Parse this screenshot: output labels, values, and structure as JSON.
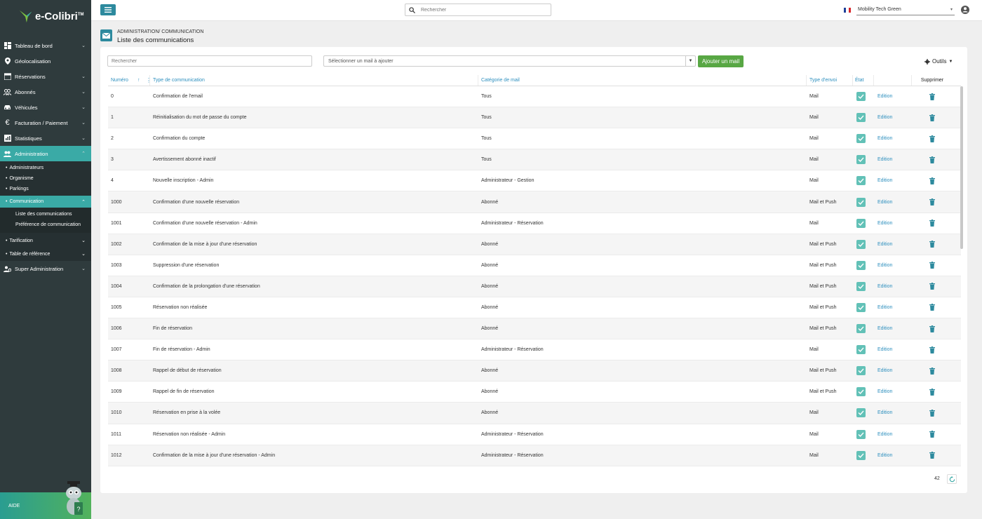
{
  "app": {
    "logo_text": "e-Colibri",
    "logo_tm": "TM"
  },
  "sidebar": {
    "items": [
      {
        "label": "Tableau de bord"
      },
      {
        "label": "Géolocalisation"
      },
      {
        "label": "Réservations"
      },
      {
        "label": "Abonnés"
      },
      {
        "label": "Véhicules"
      },
      {
        "label": "Facturation / Paiement"
      },
      {
        "label": "Statistiques"
      },
      {
        "label": "Administration"
      }
    ],
    "admin_sub": [
      {
        "label": "Administrateurs"
      },
      {
        "label": "Organisme"
      },
      {
        "label": "Parkings"
      },
      {
        "label": "Communication"
      }
    ],
    "comm_sub": [
      {
        "label": "Liste des communications"
      },
      {
        "label": "Préférence de communication"
      }
    ],
    "admin_sub2": [
      {
        "label": "Tarification"
      },
      {
        "label": "Table de référence"
      }
    ],
    "super_admin": "Super Administration",
    "help": "AIDE"
  },
  "topbar": {
    "search_placeholder": "Rechercher",
    "org": "Mobility Tech Green"
  },
  "header": {
    "breadcrumb": "ADMINISTRATION/ COMMUNICATION",
    "title": "Liste des communications"
  },
  "toolbar": {
    "search_placeholder": "Rechercher",
    "mail_select": "Sélectionner un mail à ajouter",
    "add_label": "Ajouter un mail",
    "tools_label": "Outils"
  },
  "table": {
    "headers": [
      "Numéro",
      "Type de communication",
      "Catégorie de mail",
      "Type d'envoi",
      "État",
      "Supprimer"
    ],
    "edit_label": "Edition",
    "rows": [
      {
        "num": "0",
        "type": "Confirmation de l'email",
        "cat": "Tous",
        "envoi": "Mail"
      },
      {
        "num": "1",
        "type": "Réinitialisation du mot de passe du compte",
        "cat": "Tous",
        "envoi": "Mail"
      },
      {
        "num": "2",
        "type": "Confirmation du compte",
        "cat": "Tous",
        "envoi": "Mail"
      },
      {
        "num": "3",
        "type": "Avertissement abonné inactif",
        "cat": "Tous",
        "envoi": "Mail"
      },
      {
        "num": "4",
        "type": "Nouvelle inscription - Admin",
        "cat": "Administrateur - Gestion",
        "envoi": "Mail"
      },
      {
        "num": "1000",
        "type": "Confirmation d'une nouvelle réservation",
        "cat": "Abonné",
        "envoi": "Mail et Push"
      },
      {
        "num": "1001",
        "type": "Confirmation d'une nouvelle réservation - Admin",
        "cat": "Administrateur - Réservation",
        "envoi": "Mail"
      },
      {
        "num": "1002",
        "type": "Confirmation de la mise à jour d'une réservation",
        "cat": "Abonné",
        "envoi": "Mail et Push"
      },
      {
        "num": "1003",
        "type": "Suppression d'une réservation",
        "cat": "Abonné",
        "envoi": "Mail et Push"
      },
      {
        "num": "1004",
        "type": "Confirmation de la prolongation d'une réservation",
        "cat": "Abonné",
        "envoi": "Mail et Push"
      },
      {
        "num": "1005",
        "type": "Réservation non réalisée",
        "cat": "Abonné",
        "envoi": "Mail et Push"
      },
      {
        "num": "1006",
        "type": "Fin de réservation",
        "cat": "Abonné",
        "envoi": "Mail et Push"
      },
      {
        "num": "1007",
        "type": "Fin de réservation - Admin",
        "cat": "Administrateur - Réservation",
        "envoi": "Mail"
      },
      {
        "num": "1008",
        "type": "Rappel de début de réservation",
        "cat": "Abonné",
        "envoi": "Mail et Push"
      },
      {
        "num": "1009",
        "type": "Rappel de fin de réservation",
        "cat": "Abonné",
        "envoi": "Mail et Push"
      },
      {
        "num": "1010",
        "type": "Réservation en prise à la volée",
        "cat": "Abonné",
        "envoi": "Mail"
      },
      {
        "num": "1011",
        "type": "Réservation non réalisée - Admin",
        "cat": "Administrateur - Réservation",
        "envoi": "Mail"
      },
      {
        "num": "1012",
        "type": "Confirmation de la mise à jour d'une réservation - Admin",
        "cat": "Administrateur - Réservation",
        "envoi": "Mail"
      }
    ]
  },
  "footer": {
    "count": "42"
  },
  "colors": {
    "teal": "#3aaaa6",
    "sidebar": "#2f3b3d",
    "link": "#2d8fbe",
    "add_button": "#58a744"
  }
}
